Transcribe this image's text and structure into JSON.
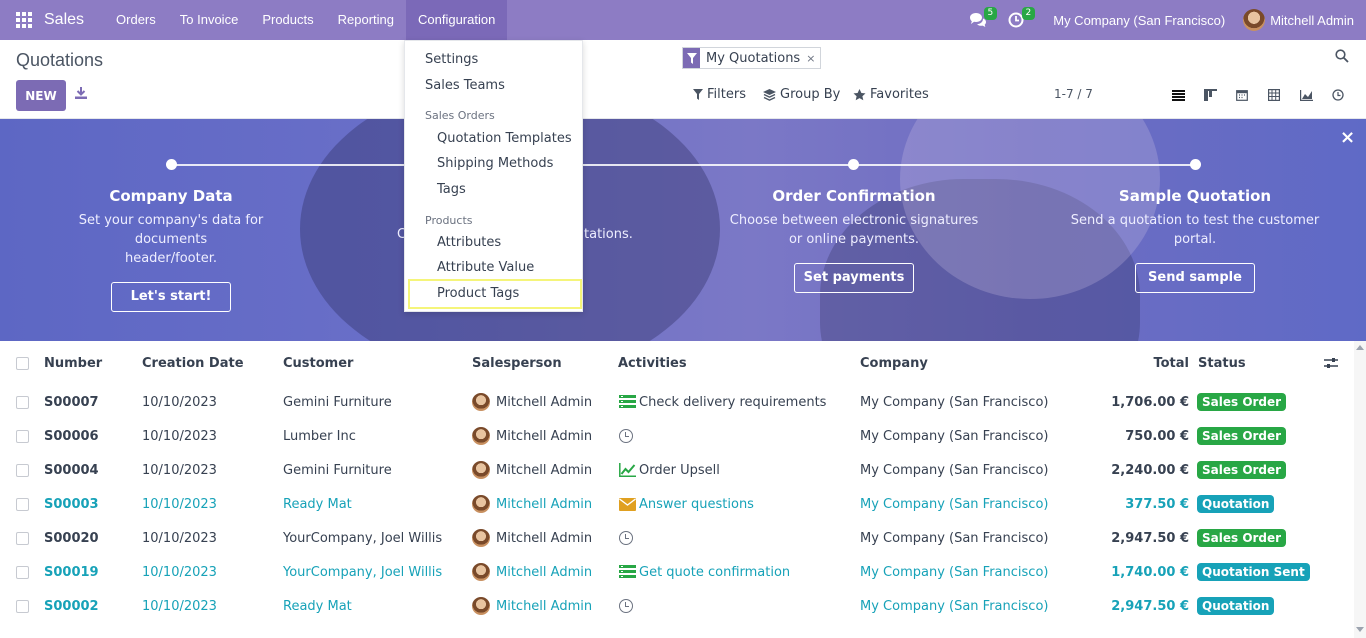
{
  "navbar": {
    "brand": "Sales",
    "menu": [
      "Orders",
      "To Invoice",
      "Products",
      "Reporting",
      "Configuration"
    ],
    "messages_count": "5",
    "activities_count": "2",
    "company": "My Company (San Francisco)",
    "user": "Mitchell Admin"
  },
  "control_panel": {
    "title": "Quotations",
    "new_label": "NEW",
    "facet": "My Quotations",
    "facet_remove": "×",
    "filters": "Filters",
    "group_by": "Group By",
    "favorites": "Favorites",
    "pager": "1-7 / 7"
  },
  "config_menu": {
    "settings": "Settings",
    "sales_teams": "Sales Teams",
    "sales_orders_header": "Sales Orders",
    "quotation_templates": "Quotation Templates",
    "shipping_methods": "Shipping Methods",
    "tags": "Tags",
    "products_header": "Products",
    "attributes": "Attributes",
    "attribute_value": "Attribute Value",
    "product_tags": "Product Tags"
  },
  "banner": {
    "close": "×",
    "steps": [
      {
        "title": "Company Data",
        "desc1": "Set your company's data for documents",
        "desc2": "header/footer.",
        "button": "Let's start!"
      },
      {
        "title": "",
        "desc1": "",
        "desc2": "",
        "partial_left": "C",
        "partial_right": "tations.",
        "button": ""
      },
      {
        "title": "Order Confirmation",
        "desc1": "Choose between electronic signatures",
        "desc2": "or online payments.",
        "button": "Set payments"
      },
      {
        "title": "Sample Quotation",
        "desc1": "Send a quotation to test the customer",
        "desc2": "portal.",
        "button": "Send sample"
      }
    ]
  },
  "table": {
    "headers": {
      "number": "Number",
      "creation_date": "Creation Date",
      "customer": "Customer",
      "salesperson": "Salesperson",
      "activities": "Activities",
      "company": "Company",
      "total": "Total",
      "status": "Status"
    },
    "rows": [
      {
        "number": "S00007",
        "date": "10/10/2023",
        "customer": "Gemini Furniture",
        "salesperson": "Mitchell Admin",
        "activity": "Check delivery requirements",
        "activity_icon": "list-icon",
        "company": "My Company (San Francisco)",
        "total": "1,706.00 €",
        "status": "Sales Order"
      },
      {
        "number": "S00006",
        "date": "10/10/2023",
        "customer": "Lumber Inc",
        "salesperson": "Mitchell Admin",
        "activity": "",
        "activity_icon": "clock-icon",
        "company": "My Company (San Francisco)",
        "total": "750.00 €",
        "status": "Sales Order"
      },
      {
        "number": "S00004",
        "date": "10/10/2023",
        "customer": "Gemini Furniture",
        "salesperson": "Mitchell Admin",
        "activity": "Order Upsell",
        "activity_icon": "chart-icon",
        "company": "My Company (San Francisco)",
        "total": "2,240.00 €",
        "status": "Sales Order"
      },
      {
        "number": "S00003",
        "date": "10/10/2023",
        "customer": "Ready Mat",
        "salesperson": "Mitchell Admin",
        "activity": "Answer questions",
        "activity_icon": "envelope-icon",
        "company": "My Company (San Francisco)",
        "total": "377.50 €",
        "status": "Quotation"
      },
      {
        "number": "S00020",
        "date": "10/10/2023",
        "customer": "YourCompany, Joel Willis",
        "salesperson": "Mitchell Admin",
        "activity": "",
        "activity_icon": "clock-icon",
        "company": "My Company (San Francisco)",
        "total": "2,947.50 €",
        "status": "Sales Order"
      },
      {
        "number": "S00019",
        "date": "10/10/2023",
        "customer": "YourCompany, Joel Willis",
        "salesperson": "Mitchell Admin",
        "activity": "Get quote confirmation",
        "activity_icon": "list-icon",
        "company": "My Company (San Francisco)",
        "total": "1,740.00 €",
        "status": "Quotation Sent"
      },
      {
        "number": "S00002",
        "date": "10/10/2023",
        "customer": "Ready Mat",
        "salesperson": "Mitchell Admin",
        "activity": "",
        "activity_icon": "clock-icon",
        "company": "My Company (San Francisco)",
        "total": "2,947.50 €",
        "status": "Quotation"
      }
    ]
  }
}
